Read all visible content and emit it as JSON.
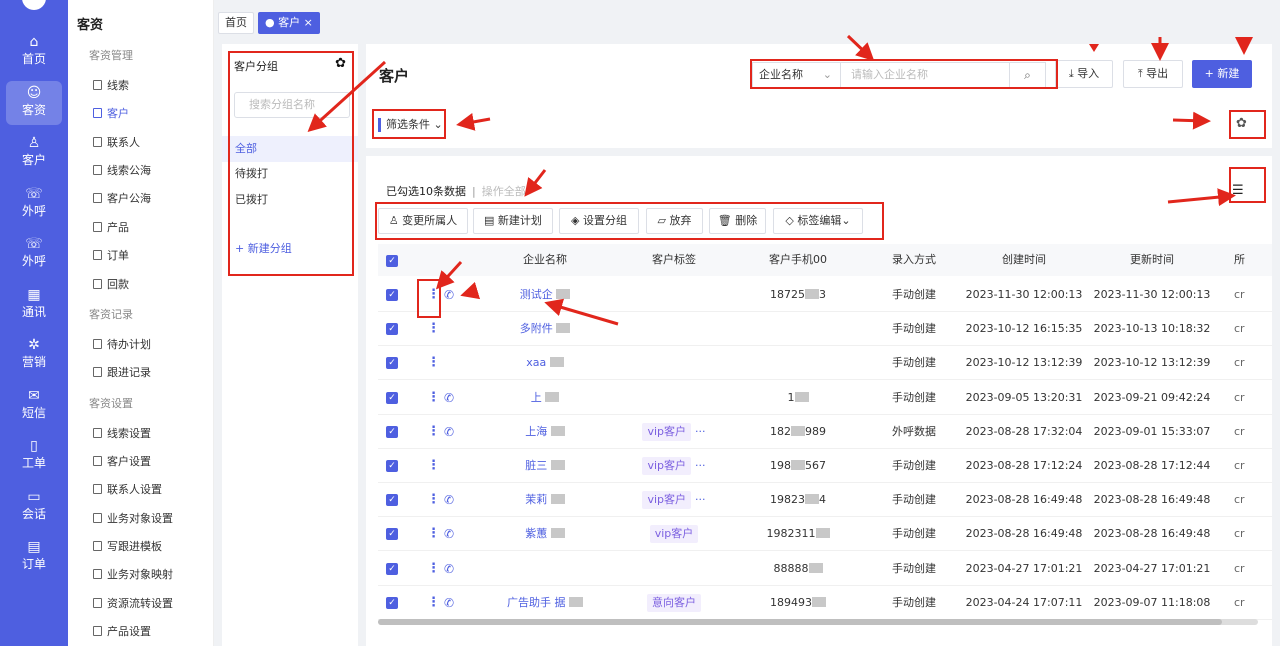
{
  "nav": {
    "items": [
      {
        "icon": "home-icon",
        "glyph": "⌂",
        "label": "首页"
      },
      {
        "icon": "users-icon",
        "glyph": "☺",
        "label": "客资"
      },
      {
        "icon": "person-icon",
        "glyph": "♙",
        "label": "客户"
      },
      {
        "icon": "call-out-icon",
        "glyph": "☏",
        "label": "外呼"
      },
      {
        "icon": "call-in-icon",
        "glyph": "☏",
        "label": "外呼"
      },
      {
        "icon": "contacts-icon",
        "glyph": "▦",
        "label": "通讯"
      },
      {
        "icon": "marketing-icon",
        "glyph": "✲",
        "label": "营销"
      },
      {
        "icon": "sms-icon",
        "glyph": "✉",
        "label": "短信"
      },
      {
        "icon": "ticket-icon",
        "glyph": "▯",
        "label": "工单"
      },
      {
        "icon": "chat-icon",
        "glyph": "▭",
        "label": "会话"
      },
      {
        "icon": "order-icon",
        "glyph": "▤",
        "label": "订单"
      }
    ]
  },
  "menu": {
    "title": "客资",
    "groups": {
      "g1": "客资管理",
      "g2": "客资记录",
      "g3": "客资设置"
    },
    "items": {
      "m1": "线索",
      "m2": "客户",
      "m3": "联系人",
      "m4": "线索公海",
      "m5": "客户公海",
      "m6": "产品",
      "m7": "订单",
      "m8": "回款",
      "m9": "待办计划",
      "m10": "跟进记录",
      "m11": "线索设置",
      "m12": "客户设置",
      "m13": "联系人设置",
      "m14": "业务对象设置",
      "m15": "写跟进模板",
      "m16": "业务对象映射",
      "m17": "资源流转设置",
      "m18": "产品设置"
    }
  },
  "tabs": {
    "home": "首页",
    "customer": "● 客户 ×"
  },
  "groups_panel": {
    "title": "客户分组",
    "search_placeholder": "搜索分组名称",
    "items": [
      "全部",
      "待拨打",
      "已拨打"
    ],
    "add_label": "+ 新建分组"
  },
  "header": {
    "title": "客户",
    "search_field": "企业名称",
    "search_placeholder": "请输入企业名称",
    "import_label": "⤓ 导入",
    "export_label": "⤒ 导出",
    "new_label": "+ 新建",
    "filter_label": "筛选条件 ⌄"
  },
  "toolbar": {
    "selected_text": "已勾选10条数据",
    "separator": "|",
    "operate_all": "操作全部",
    "actions": [
      "♙ 变更所属人",
      "▤ 新建计划",
      "◈ 设置分组",
      "▱ 放弃",
      "🗑 删除",
      "◇ 标签编辑⌄"
    ]
  },
  "table": {
    "headers": [
      "企业名称",
      "客户标签",
      "客户手机00",
      "录入方式",
      "创建时间",
      "更新时间",
      "所"
    ],
    "rows": [
      {
        "name": "测试企",
        "tag": "",
        "phone": "18725",
        "phone_end": "3",
        "source": "手动创建",
        "created": "2023-11-30 12:00:13",
        "updated": "2023-11-30 12:00:13",
        "owner": "cr",
        "call": true
      },
      {
        "name": "多附件",
        "tag": "",
        "phone": "",
        "phone_end": "",
        "source": "手动创建",
        "created": "2023-10-12 16:15:35",
        "updated": "2023-10-13 10:18:32",
        "owner": "cr",
        "call": false
      },
      {
        "name": "xaa",
        "tag": "",
        "phone": "",
        "phone_end": "",
        "source": "手动创建",
        "created": "2023-10-12 13:12:39",
        "updated": "2023-10-12 13:12:39",
        "owner": "cr",
        "call": false
      },
      {
        "name": "上",
        "tag": "",
        "phone": "1",
        "phone_end": "",
        "source": "手动创建",
        "created": "2023-09-05 13:20:31",
        "updated": "2023-09-21 09:42:24",
        "owner": "cr",
        "call": true
      },
      {
        "name": "上海",
        "tag": "vip客户",
        "phone": "182",
        "phone_end": "989",
        "source": "外呼数据",
        "created": "2023-08-28 17:32:04",
        "updated": "2023-09-01 15:33:07",
        "owner": "cr",
        "call": true
      },
      {
        "name": "脏三",
        "tag": "vip客户",
        "phone": "198",
        "phone_end": "567",
        "source": "手动创建",
        "created": "2023-08-28 17:12:24",
        "updated": "2023-08-28 17:12:44",
        "owner": "cr",
        "call": false
      },
      {
        "name": "茉莉",
        "tag": "vip客户",
        "phone": "19823",
        "phone_end": "4",
        "source": "手动创建",
        "created": "2023-08-28 16:49:48",
        "updated": "2023-08-28 16:49:48",
        "owner": "cr",
        "call": true
      },
      {
        "name": "紫蕙",
        "tag": "vip客户",
        "phone": "1982311",
        "phone_end": "",
        "source": "手动创建",
        "created": "2023-08-28 16:49:48",
        "updated": "2023-08-28 16:49:48",
        "owner": "cr",
        "call": true
      },
      {
        "name": "",
        "tag": "",
        "phone": "88888",
        "phone_end": "",
        "source": "手动创建",
        "created": "2023-04-27 17:01:21",
        "updated": "2023-04-27 17:01:21",
        "owner": "cr",
        "call": true
      },
      {
        "name": "广告助手 据",
        "tag": "意向客户",
        "phone": "189493",
        "phone_end": "",
        "source": "手动创建",
        "created": "2023-04-24 17:07:11",
        "updated": "2023-09-07 11:18:08",
        "owner": "cr",
        "call": true
      }
    ],
    "tag_more": "···",
    "more_glyph": "⋮",
    "phone_glyph": "✆",
    "check_glyph": "✓"
  },
  "icons": {
    "gear": "✿",
    "search": "⌕",
    "columns": "☰"
  }
}
